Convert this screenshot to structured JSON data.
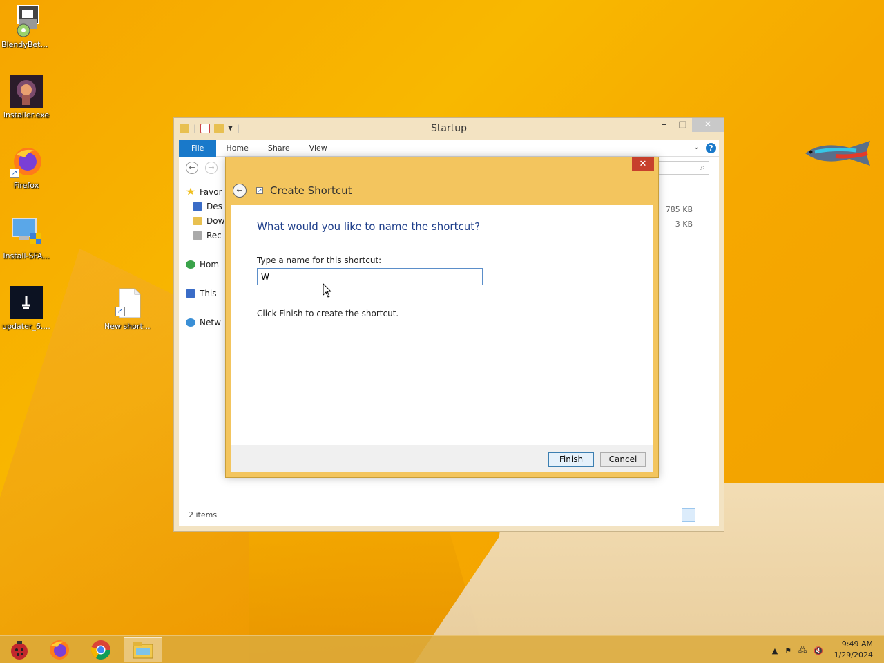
{
  "desktop": {
    "icons": [
      {
        "label": "BlendyBeta..."
      },
      {
        "label": "installer.exe"
      },
      {
        "label": "Firefox"
      },
      {
        "label": "Install-SFA..."
      },
      {
        "label": "updater_6...."
      },
      {
        "label": "New shortcut"
      }
    ]
  },
  "explorer": {
    "title": "Startup",
    "ribbon_tabs": [
      "File",
      "Home",
      "Share",
      "View"
    ],
    "nav_items": [
      "Favor",
      "Des",
      "Dow",
      "Rec",
      "Hom",
      "This",
      "Netw"
    ],
    "file_sizes": [
      "785 KB",
      "3 KB"
    ],
    "status": "2 items"
  },
  "dialog": {
    "title": "Create Shortcut",
    "heading": "What would you like to name the shortcut?",
    "field_label": "Type a name for this shortcut:",
    "field_value": "W",
    "hint": "Click Finish to create the shortcut.",
    "finish_label": "Finish",
    "cancel_label": "Cancel"
  },
  "taskbar": {
    "time": "9:49 AM",
    "date": "1/29/2024"
  }
}
